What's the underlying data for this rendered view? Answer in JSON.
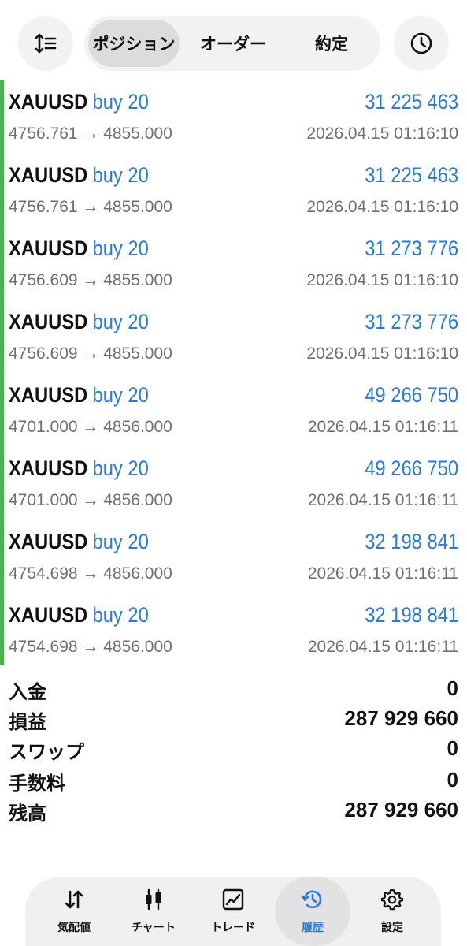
{
  "header": {
    "tabs": [
      {
        "label": "ポジション",
        "active": true
      },
      {
        "label": "オーダー",
        "active": false
      },
      {
        "label": "約定",
        "active": false
      }
    ],
    "left_icon": "sort-icon",
    "right_icon": "clock-icon"
  },
  "colors": {
    "accent": "#2a7ad6",
    "bar": "#4caf50"
  },
  "positions": [
    {
      "symbol": "XAUUSD",
      "side": "buy 20",
      "profit": "31 225 463",
      "prices": "4756.761 → 4855.000",
      "time": "2026.04.15 01:16:10"
    },
    {
      "symbol": "XAUUSD",
      "side": "buy 20",
      "profit": "31 225 463",
      "prices": "4756.761 → 4855.000",
      "time": "2026.04.15 01:16:10"
    },
    {
      "symbol": "XAUUSD",
      "side": "buy 20",
      "profit": "31 273 776",
      "prices": "4756.609 → 4855.000",
      "time": "2026.04.15 01:16:10"
    },
    {
      "symbol": "XAUUSD",
      "side": "buy 20",
      "profit": "31 273 776",
      "prices": "4756.609 → 4855.000",
      "time": "2026.04.15 01:16:10"
    },
    {
      "symbol": "XAUUSD",
      "side": "buy 20",
      "profit": "49 266 750",
      "prices": "4701.000 → 4856.000",
      "time": "2026.04.15 01:16:11"
    },
    {
      "symbol": "XAUUSD",
      "side": "buy 20",
      "profit": "49 266 750",
      "prices": "4701.000 → 4856.000",
      "time": "2026.04.15 01:16:11"
    },
    {
      "symbol": "XAUUSD",
      "side": "buy 20",
      "profit": "32 198 841",
      "prices": "4754.698 → 4856.000",
      "time": "2026.04.15 01:16:11"
    },
    {
      "symbol": "XAUUSD",
      "side": "buy 20",
      "profit": "32 198 841",
      "prices": "4754.698 → 4856.000",
      "time": "2026.04.15 01:16:11"
    }
  ],
  "summary": [
    {
      "label": "入金",
      "value": "0"
    },
    {
      "label": "損益",
      "value": "287 929 660"
    },
    {
      "label": "スワップ",
      "value": "0"
    },
    {
      "label": "手数料",
      "value": "0"
    },
    {
      "label": "残高",
      "value": "287 929 660"
    }
  ],
  "nav": [
    {
      "label": "気配値",
      "icon": "arrows-up-down-icon",
      "active": false
    },
    {
      "label": "チャート",
      "icon": "candlestick-icon",
      "active": false
    },
    {
      "label": "トレード",
      "icon": "trend-chart-icon",
      "active": false
    },
    {
      "label": "履歴",
      "icon": "history-icon",
      "active": true
    },
    {
      "label": "設定",
      "icon": "gear-icon",
      "active": false
    }
  ]
}
